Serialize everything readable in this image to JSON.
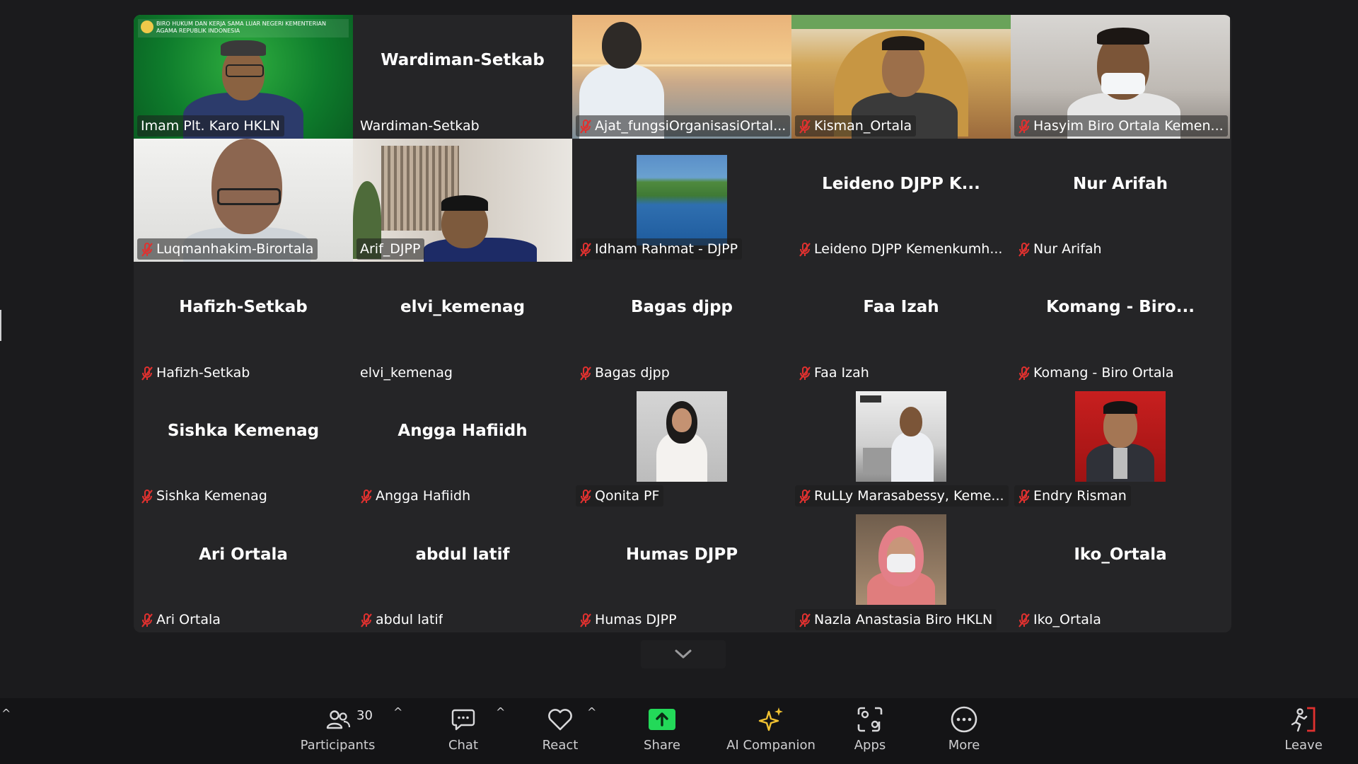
{
  "meeting": {
    "tiles": [
      {
        "center_name": "",
        "tag": "Imam Plt. Karo HKLN",
        "muted": false,
        "video": "green-banner",
        "active": true,
        "banner_text": "BIRO HUKUM DAN KERJA SAMA LUAR NEGERI KEMENTERIAN AGAMA REPUBLIK INDONESIA"
      },
      {
        "center_name": "Wardiman-Setkab",
        "tag": "Wardiman-Setkab",
        "muted": false,
        "video": "none"
      },
      {
        "center_name": "",
        "tag": "Ajat_fungsiOrganisasiOrtal...",
        "muted": true,
        "video": "sunset"
      },
      {
        "center_name": "",
        "tag": "Kisman_Ortala",
        "muted": true,
        "video": "ceremony"
      },
      {
        "center_name": "",
        "tag": "Hasyim Biro Ortala Kemen...",
        "muted": true,
        "video": "office"
      },
      {
        "center_name": "",
        "tag": "Luqmanhakim-Birortala",
        "muted": true,
        "video": "white"
      },
      {
        "center_name": "",
        "tag": "Arif_DJPP",
        "muted": false,
        "video": "library"
      },
      {
        "center_name": "",
        "tag": "Idham Rahmat - DJPP",
        "muted": true,
        "video": "avatar-lake"
      },
      {
        "center_name": "Leideno DJPP K...",
        "tag": "Leideno DJPP Kemenkumh...",
        "muted": true,
        "video": "none"
      },
      {
        "center_name": "Nur Arifah",
        "tag": "Nur Arifah",
        "muted": true,
        "video": "none"
      },
      {
        "center_name": "Hafizh-Setkab",
        "tag": "Hafizh-Setkab",
        "muted": true,
        "video": "none"
      },
      {
        "center_name": "elvi_kemenag",
        "tag": "elvi_kemenag",
        "muted": false,
        "video": "none"
      },
      {
        "center_name": "Bagas djpp",
        "tag": "Bagas djpp",
        "muted": true,
        "video": "none"
      },
      {
        "center_name": "Faa Izah",
        "tag": "Faa Izah",
        "muted": true,
        "video": "none"
      },
      {
        "center_name": "Komang - Biro...",
        "tag": "Komang - Biro Ortala",
        "muted": true,
        "video": "none"
      },
      {
        "center_name": "Sishka Kemenag",
        "tag": "Sishka Kemenag",
        "muted": true,
        "video": "none"
      },
      {
        "center_name": "Angga Hafiidh",
        "tag": "Angga Hafiidh",
        "muted": true,
        "video": "none"
      },
      {
        "center_name": "",
        "tag": "Qonita PF",
        "muted": true,
        "video": "avatar-hijab"
      },
      {
        "center_name": "",
        "tag": "RuLLy Marasabessy, Keme...",
        "muted": true,
        "video": "avatar-desk"
      },
      {
        "center_name": "",
        "tag": "Endry Risman",
        "muted": true,
        "video": "avatar-red"
      },
      {
        "center_name": "Ari Ortala",
        "tag": "Ari Ortala",
        "muted": true,
        "video": "none"
      },
      {
        "center_name": "abdul latif",
        "tag": "abdul latif",
        "muted": true,
        "video": "none"
      },
      {
        "center_name": "Humas DJPP",
        "tag": "Humas DJPP",
        "muted": true,
        "video": "none"
      },
      {
        "center_name": "",
        "tag": "Nazla Anastasia Biro HKLN",
        "muted": true,
        "video": "avatar-mask"
      },
      {
        "center_name": "Iko_Ortala",
        "tag": "Iko_Ortala",
        "muted": true,
        "video": "none"
      }
    ]
  },
  "toolbar": {
    "participants_label": "Participants",
    "participants_count": "30",
    "chat_label": "Chat",
    "react_label": "React",
    "share_label": "Share",
    "ai_label": "AI Companion",
    "apps_label": "Apps",
    "more_label": "More",
    "leave_label": "Leave"
  },
  "colors": {
    "active_speaker": "#23d959",
    "muted_red": "#e0312f",
    "share_green": "#23d959",
    "ai_gold": "#f1c232",
    "leave_red": "#e0312f"
  }
}
